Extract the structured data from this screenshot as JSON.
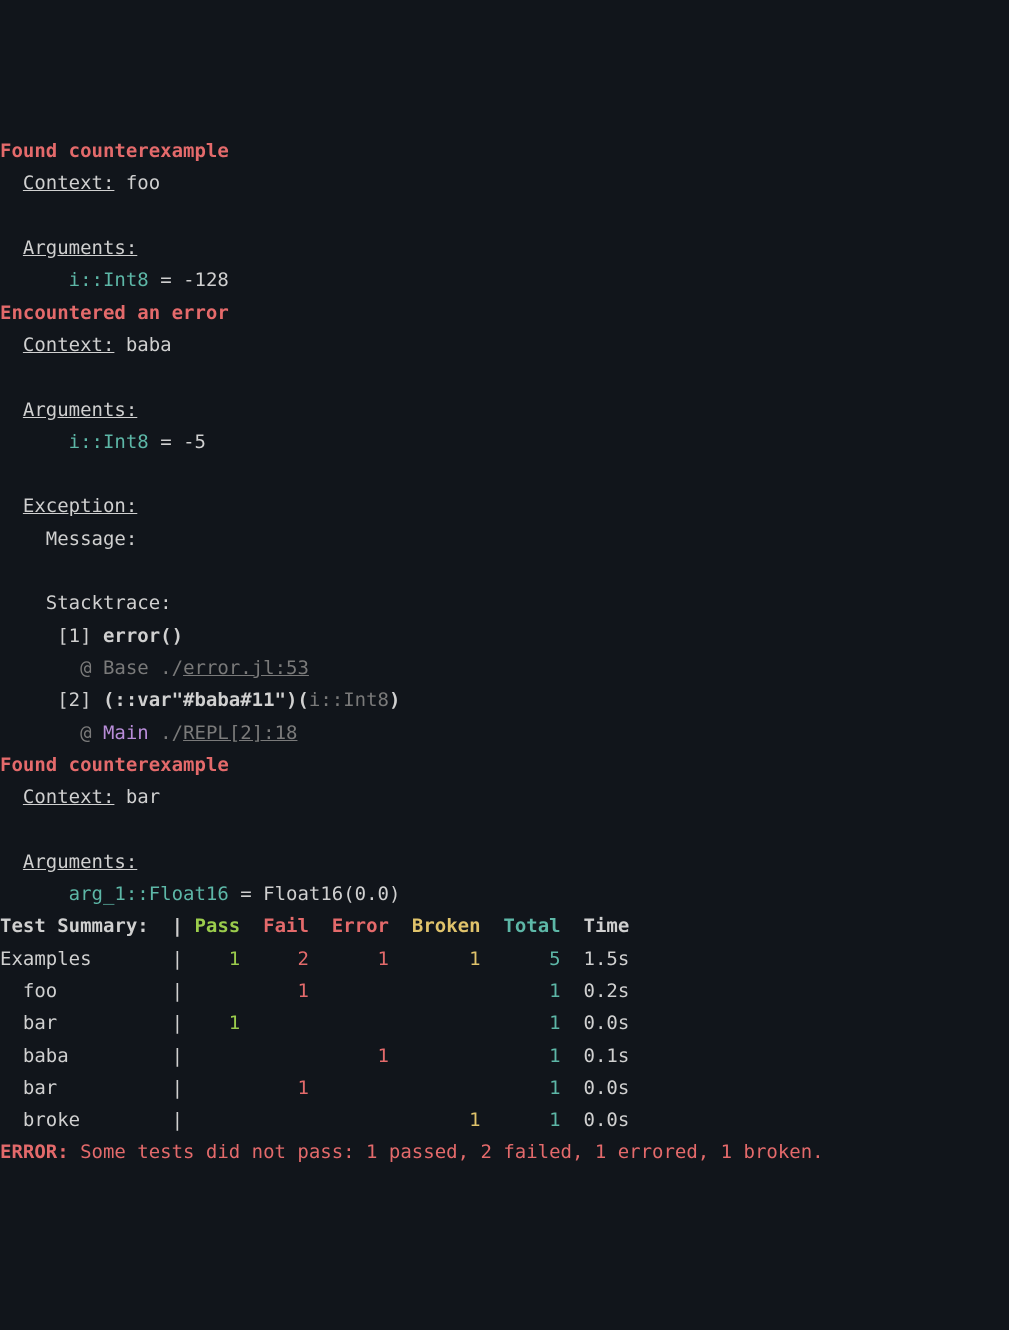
{
  "sections": [
    {
      "heading": "Found counterexample",
      "context": "foo",
      "argLine": "      i::Int8 = -128",
      "argName": "i",
      "argType": "Int8",
      "argVal": "-128"
    },
    {
      "heading": "Encountered an error",
      "context": "baba",
      "argLine": "      i::Int8 = -5",
      "argName": "i",
      "argType": "Int8",
      "argVal": "-5",
      "exception": {
        "messageLabel": "Message:",
        "stackLabel": "Stacktrace:",
        "frames": [
          {
            "idx": "[1]",
            "sig": "error()",
            "at": "@",
            "module": "Base",
            "path": "./",
            "file": "error.jl:53"
          },
          {
            "idx": "[2]",
            "sigPrefix": "(::var\"#baba#11\")(",
            "sigArg": "i::Int8",
            "sigSuffix": ")",
            "at": "@",
            "module": "Main",
            "path": "./",
            "file": "REPL[2]:18",
            "moduleColor": "mag"
          }
        ]
      }
    },
    {
      "heading": "Found counterexample",
      "context": "bar",
      "argLine": "      arg_1::Float16 = Float16(0.0)",
      "argName": "arg_1",
      "argType": "Float16",
      "argVal": "Float16(0.0)"
    }
  ],
  "labels": {
    "contextLabel": "Context:",
    "argumentsLabel": "Arguments:",
    "exceptionLabel": "Exception:"
  },
  "summary": {
    "heading": "Test Summary:",
    "cols": [
      "Pass",
      "Fail",
      "Error",
      "Broken",
      "Total",
      "Time"
    ],
    "rows": [
      {
        "name": "Examples",
        "pass": "1",
        "fail": "2",
        "error": "1",
        "broken": "1",
        "total": "5",
        "time": "1.5s",
        "indent": 0
      },
      {
        "name": "foo",
        "pass": "",
        "fail": "1",
        "error": "",
        "broken": "",
        "total": "1",
        "time": "0.2s",
        "indent": 1
      },
      {
        "name": "bar",
        "pass": "1",
        "fail": "",
        "error": "",
        "broken": "",
        "total": "1",
        "time": "0.0s",
        "indent": 1
      },
      {
        "name": "baba",
        "pass": "",
        "fail": "",
        "error": "1",
        "broken": "",
        "total": "1",
        "time": "0.1s",
        "indent": 1
      },
      {
        "name": "bar",
        "pass": "",
        "fail": "1",
        "error": "",
        "broken": "",
        "total": "1",
        "time": "0.0s",
        "indent": 1
      },
      {
        "name": "broke",
        "pass": "",
        "fail": "",
        "error": "",
        "broken": "1",
        "total": "1",
        "time": "0.0s",
        "indent": 1
      }
    ]
  },
  "errorLine": {
    "prefix": "ERROR:",
    "text": " Some tests did not pass: 1 passed, 2 failed, 1 errored, 1 broken."
  }
}
